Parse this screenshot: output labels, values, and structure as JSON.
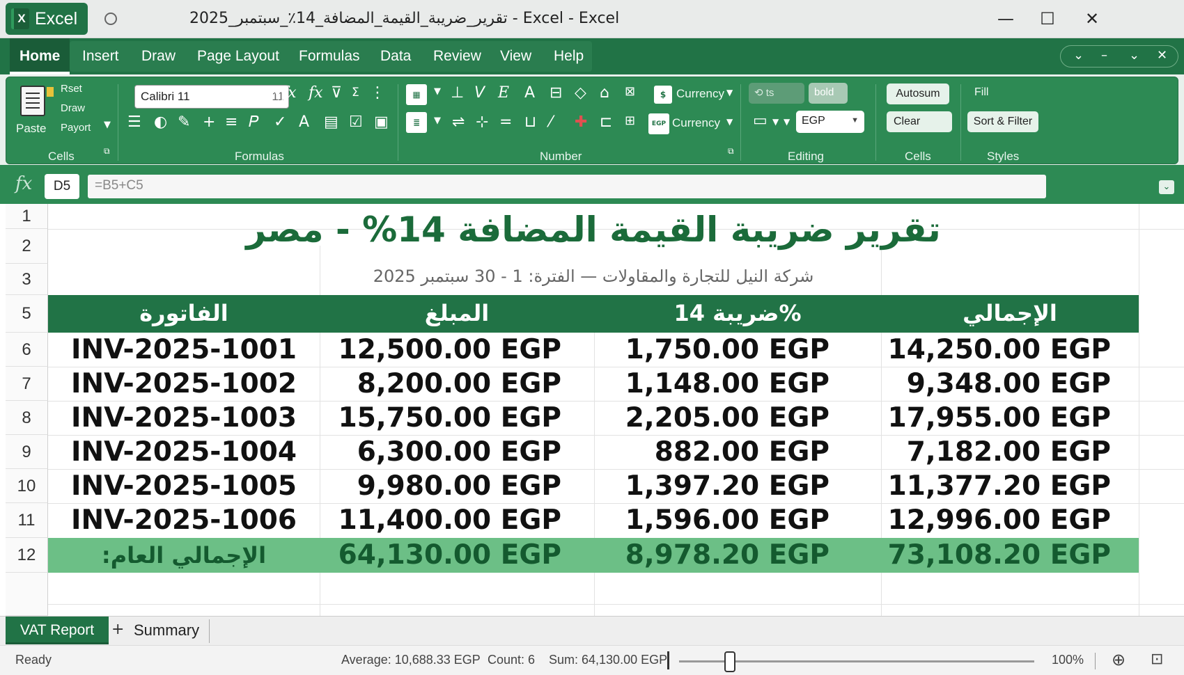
{
  "app": {
    "name": "Excel",
    "window_title": "تقرير_ضريبة_القيمة_المضافة_14٪_سبتمبر_2025 - Excel - Excel"
  },
  "window_controls": {
    "minimize": "—",
    "maximize": "☐",
    "close": "✕"
  },
  "ribbon_tabs": [
    "Home",
    "Insert",
    "Draw",
    "Page Layout",
    "Formulas",
    "Data",
    "Review",
    "View",
    "Help"
  ],
  "ribbon_ctrl": {
    "a": "⌄",
    "b": "–",
    "c": "⌄",
    "d": "✕"
  },
  "ribbon": {
    "paste_label": "Paste",
    "clipboard_items": [
      "Rset",
      "Draw",
      "Payort"
    ],
    "font_name": "Calibri 11",
    "font_size": "11",
    "currency_1": "Currency",
    "currency_2": "Currency",
    "egp_select": "EGP",
    "bold_btn": "bold",
    "format_btn": "ts",
    "autosum": "Autosum",
    "clear": "Clear",
    "fill": "Fill",
    "sort_filter": "Sort & Filter",
    "groups": {
      "cells_left": "Cells",
      "formulas": "Formulas",
      "number": "Number",
      "editing": "Editing",
      "cells_right": "Cells",
      "styles": "Styles"
    }
  },
  "formula_bar": {
    "fx": "fx",
    "cell_ref": "D5",
    "formula": "=B5+C5"
  },
  "sheet": {
    "row_numbers": [
      "1",
      "2",
      "3",
      "5",
      "6",
      "7",
      "8",
      "9",
      "10",
      "11",
      "12"
    ],
    "title": "تقرير ضريبة القيمة المضافة 14% - مصر",
    "subtitle": "شركة النيل للتجارة والمقاولات — الفترة: 1 - 30 سبتمبر 2025",
    "headers": [
      "الفاتورة",
      "المبلغ",
      "ضريبة 14%",
      "الإجمالي"
    ],
    "rows": [
      [
        "INV-2025-1001",
        "12,500.00 EGP",
        "1,750.00 EGP",
        "14,250.00 EGP"
      ],
      [
        "INV-2025-1002",
        "8,200.00 EGP",
        "1,148.00 EGP",
        "9,348.00 EGP"
      ],
      [
        "INV-2025-1003",
        "15,750.00 EGP",
        "2,205.00 EGP",
        "17,955.00 EGP"
      ],
      [
        "INV-2025-1004",
        "6,300.00 EGP",
        "882.00 EGP",
        "7,182.00 EGP"
      ],
      [
        "INV-2025-1005",
        "9,980.00 EGP",
        "1,397.20 EGP",
        "11,377.20 EGP"
      ],
      [
        "INV-2025-1006",
        "11,400.00 EGP",
        "1,596.00 EGP",
        "12,996.00 EGP"
      ]
    ],
    "total_row": [
      "الإجمالي العام:",
      "64,130.00 EGP",
      "8,978.20 EGP",
      "73,108.20 EGP"
    ]
  },
  "sheet_tabs": {
    "active": "VAT Report",
    "add": "+",
    "other": "Summary"
  },
  "status_bar": {
    "ready": "Ready",
    "average": "Average: 10,688.33 EGP",
    "count": "Count: 6",
    "sum": "Sum: 64,130.00 EGP",
    "zoom": "100%"
  },
  "colors": {
    "excel_green": "#217346",
    "ribbon_green": "#2d8a54",
    "header_fill": "#217346",
    "total_fill": "#6cbf86",
    "title_text": "#1b6b3a"
  }
}
